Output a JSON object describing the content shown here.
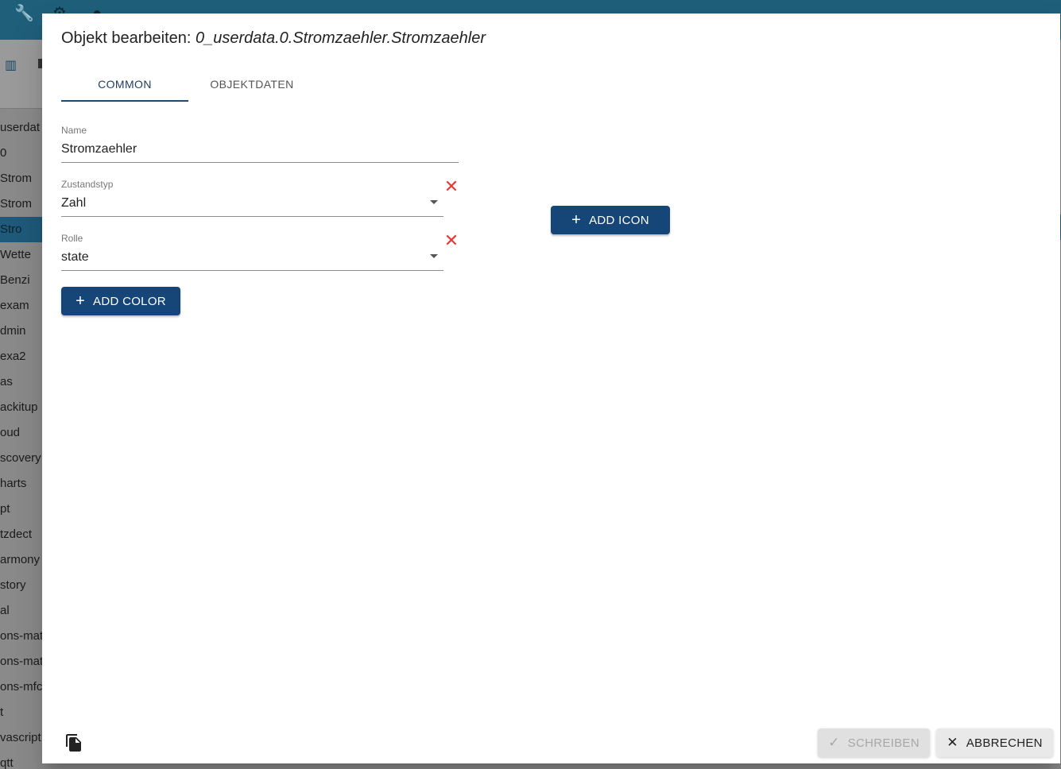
{
  "background": {
    "tree_items": [
      "userdat",
      "0",
      "Strom",
      "Strom",
      "Stro",
      "Wette",
      "Benzi",
      "exam",
      "dmin",
      "exa2",
      "as",
      "ackitup",
      "oud",
      "scovery",
      "harts",
      "pt",
      "tzdect",
      "armony",
      "story",
      "al",
      "ons-mat",
      "ons-mat",
      "ons-mfc",
      "t",
      "vascript",
      "qtt"
    ]
  },
  "dialog": {
    "title_prefix": "Objekt bearbeiten:",
    "title_path": "0_userdata.0.Stromzaehler.Stromzaehler",
    "tabs": [
      {
        "label": "COMMON",
        "active": true
      },
      {
        "label": "OBJEKTDATEN",
        "active": false
      }
    ],
    "fields": {
      "name": {
        "label": "Name",
        "value": "Stromzaehler"
      },
      "state_type": {
        "label": "Zustandstyp",
        "value": "Zahl"
      },
      "role": {
        "label": "Rolle",
        "value": "state"
      }
    },
    "add_color_label": "ADD COLOR",
    "add_icon_label": "ADD ICON",
    "footer": {
      "write_label": "SCHREIBEN",
      "cancel_label": "ABBRECHEN"
    }
  },
  "colors": {
    "primary": "#164677",
    "clear_icon": "#e53935",
    "topbar": "#1f5f7a"
  }
}
